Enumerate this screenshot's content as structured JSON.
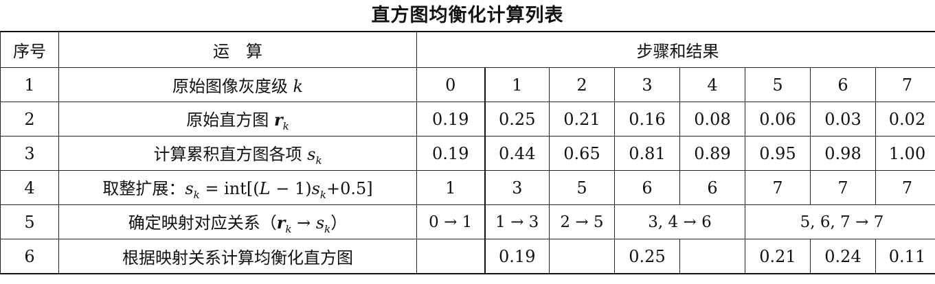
{
  "title": "直方图均衡化计算列表",
  "header": {
    "col_index": "序号",
    "col_operation": "运　算",
    "col_steps": "步骤和结果"
  },
  "rows": [
    {
      "index": "1",
      "operation_text": "原始图像灰度级 ",
      "operation_symbol": "k",
      "values": [
        "0",
        "1",
        "2",
        "3",
        "4",
        "5",
        "6",
        "7"
      ]
    },
    {
      "index": "2",
      "operation_text": "原始直方图 ",
      "operation_symbol": "r",
      "operation_sub": "k",
      "values": [
        "0.19",
        "0.25",
        "0.21",
        "0.16",
        "0.08",
        "0.06",
        "0.03",
        "0.02"
      ]
    },
    {
      "index": "3",
      "operation_text": "计算累积直方图各项 ",
      "operation_symbol": "s",
      "operation_sub": "k",
      "values": [
        "0.19",
        "0.44",
        "0.65",
        "0.81",
        "0.89",
        "0.95",
        "0.98",
        "1.00"
      ]
    },
    {
      "index": "4",
      "operation_text": "取整扩展：",
      "operation_formula_a": "s",
      "operation_formula_a_sub": "k",
      "operation_formula_b": " = int[(",
      "operation_formula_c": "L",
      "operation_formula_d": " − 1)",
      "operation_formula_e": "s",
      "operation_formula_e_sub": "k",
      "operation_formula_f": "+0.5]",
      "values": [
        "1",
        "3",
        "5",
        "6",
        "6",
        "7",
        "7",
        "7"
      ]
    },
    {
      "index": "5",
      "operation_text": "确定映射对应关系（",
      "operation_sym1": "r",
      "operation_sym1_sub": "k",
      "operation_arrow": " → ",
      "operation_sym2": "s",
      "operation_sym2_sub": "k",
      "operation_close": "）",
      "mappings": [
        "0 → 1",
        "1 → 3",
        "2 → 5",
        "3, 4 → 6",
        "5, 6, 7 → 7"
      ]
    },
    {
      "index": "6",
      "operation_text": "根据映射关系计算均衡化直方图",
      "values": [
        "",
        "0.19",
        "",
        "0.25",
        "",
        "0.21",
        "0.24",
        "0.11"
      ]
    }
  ]
}
